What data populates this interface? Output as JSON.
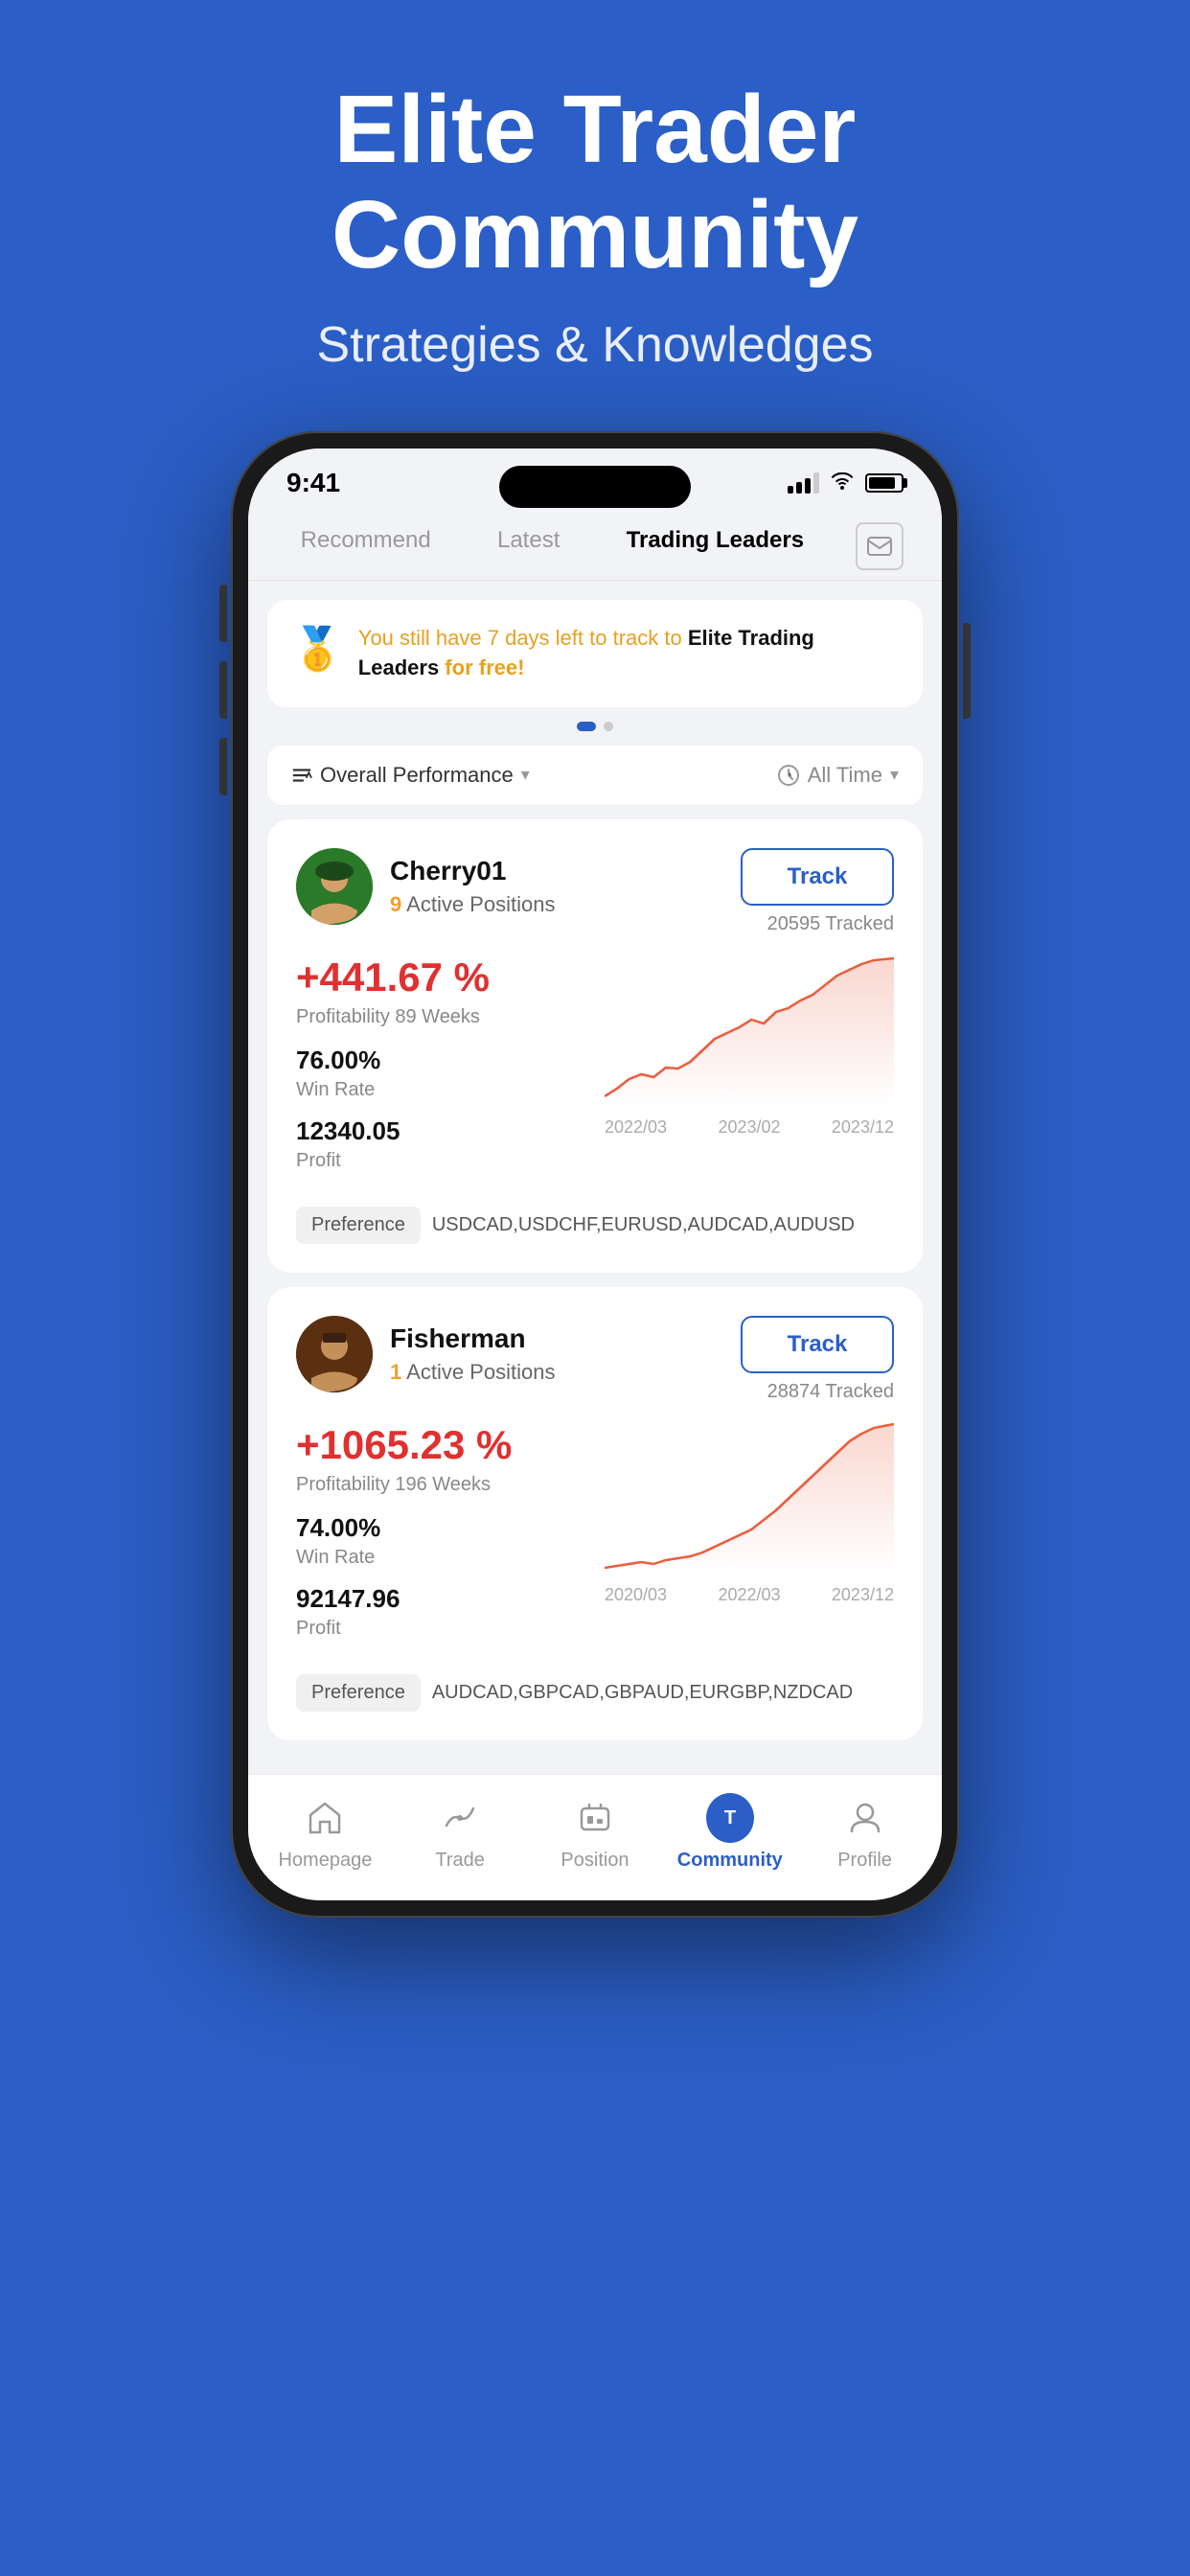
{
  "hero": {
    "title": "Elite Trader\nCommunity",
    "subtitle": "Strategies & Knowledges"
  },
  "status_bar": {
    "time": "9:41",
    "signal": 3,
    "wifi": true,
    "battery": 85
  },
  "nav_tabs": {
    "items": [
      {
        "id": "recommend",
        "label": "Recommend",
        "active": false
      },
      {
        "id": "latest",
        "label": "Latest",
        "active": false
      },
      {
        "id": "trading-leaders",
        "label": "Trading Leaders",
        "active": true
      }
    ],
    "mail_icon": "✉"
  },
  "promo_banner": {
    "icon": "🥇",
    "text_highlight": "You still have 7 days left to track to ",
    "text_bold": "Elite Trading Leaders",
    "text_end": " for free!"
  },
  "filters": {
    "performance": "Overall Performance",
    "time": "All Time"
  },
  "traders": [
    {
      "id": "cherry01",
      "name": "Cherry01",
      "active_positions": 9,
      "active_positions_label": "Active Positions",
      "track_label": "Track",
      "tracked_count": "20595 Tracked",
      "profitability": "+441.67 %",
      "profitability_detail": "Profitability  89 Weeks",
      "win_rate": "76.00%",
      "win_rate_label": "Win Rate",
      "profit": "12340.05",
      "profit_label": "Profit",
      "preference_label": "Preference",
      "preference_pairs": "USDCAD,USDCHF,EURUSD,AUDCAD,AUDUSD",
      "chart_dates": [
        "2022/03",
        "2023/02",
        "2023/12"
      ],
      "chart_data": [
        5,
        8,
        12,
        10,
        15,
        14,
        18,
        22,
        28,
        32,
        35,
        38,
        42,
        40,
        45,
        48,
        52,
        55,
        60,
        65,
        68,
        72,
        75
      ]
    },
    {
      "id": "fisherman",
      "name": "Fisherman",
      "active_positions": 1,
      "active_positions_label": "Active Positions",
      "track_label": "Track",
      "tracked_count": "28874 Tracked",
      "profitability": "+1065.23 %",
      "profitability_detail": "Profitability  196 Weeks",
      "win_rate": "74.00%",
      "win_rate_label": "Win Rate",
      "profit": "92147.96",
      "profit_label": "Profit",
      "preference_label": "Preference",
      "preference_pairs": "AUDCAD,GBPCAD,GBPAUD,EURGBP,NZDCAD",
      "chart_dates": [
        "2020/03",
        "2022/03",
        "2023/12"
      ],
      "chart_data": [
        2,
        3,
        4,
        5,
        4,
        6,
        7,
        8,
        10,
        12,
        14,
        16,
        18,
        22,
        25,
        30,
        35,
        40,
        50,
        60,
        70,
        80,
        95
      ]
    }
  ],
  "bottom_nav": {
    "items": [
      {
        "id": "homepage",
        "label": "Homepage",
        "icon": "home",
        "active": false
      },
      {
        "id": "trade",
        "label": "Trade",
        "icon": "trade",
        "active": false
      },
      {
        "id": "position",
        "label": "Position",
        "icon": "position",
        "active": false
      },
      {
        "id": "community",
        "label": "Community",
        "icon": "community",
        "active": true
      },
      {
        "id": "profile",
        "label": "Profile",
        "icon": "profile",
        "active": false
      }
    ]
  }
}
